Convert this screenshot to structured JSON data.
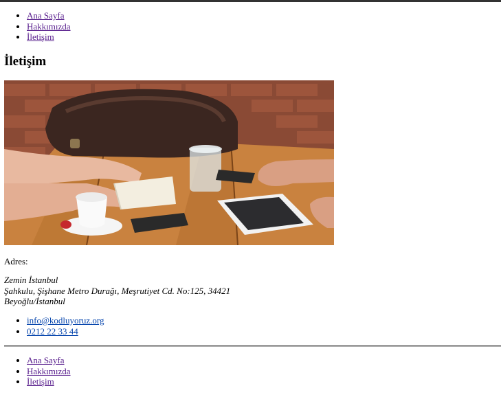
{
  "nav": {
    "items": [
      {
        "label": "Ana Sayfa"
      },
      {
        "label": "Hakkımızda"
      },
      {
        "label": "İletişim"
      }
    ]
  },
  "page": {
    "title": "İletişim"
  },
  "address": {
    "label": "Adres:",
    "lines": [
      "Zemin İstanbul",
      "Şahkulu, Şişhane Metro Durağı, Meşrutiyet Cd. No:125, 34421",
      "Beyoğlu/İstanbul"
    ]
  },
  "contact": {
    "email": "info@kodluyoruz.org",
    "phone": "0212 22 33 44"
  },
  "footer_nav": {
    "items": [
      {
        "label": "Ana Sayfa"
      },
      {
        "label": "Hakkımızda"
      },
      {
        "label": "İletişim"
      }
    ]
  },
  "colors": {
    "visited_link": "#551a8b",
    "link": "#0645ad",
    "rule": "#333333"
  }
}
